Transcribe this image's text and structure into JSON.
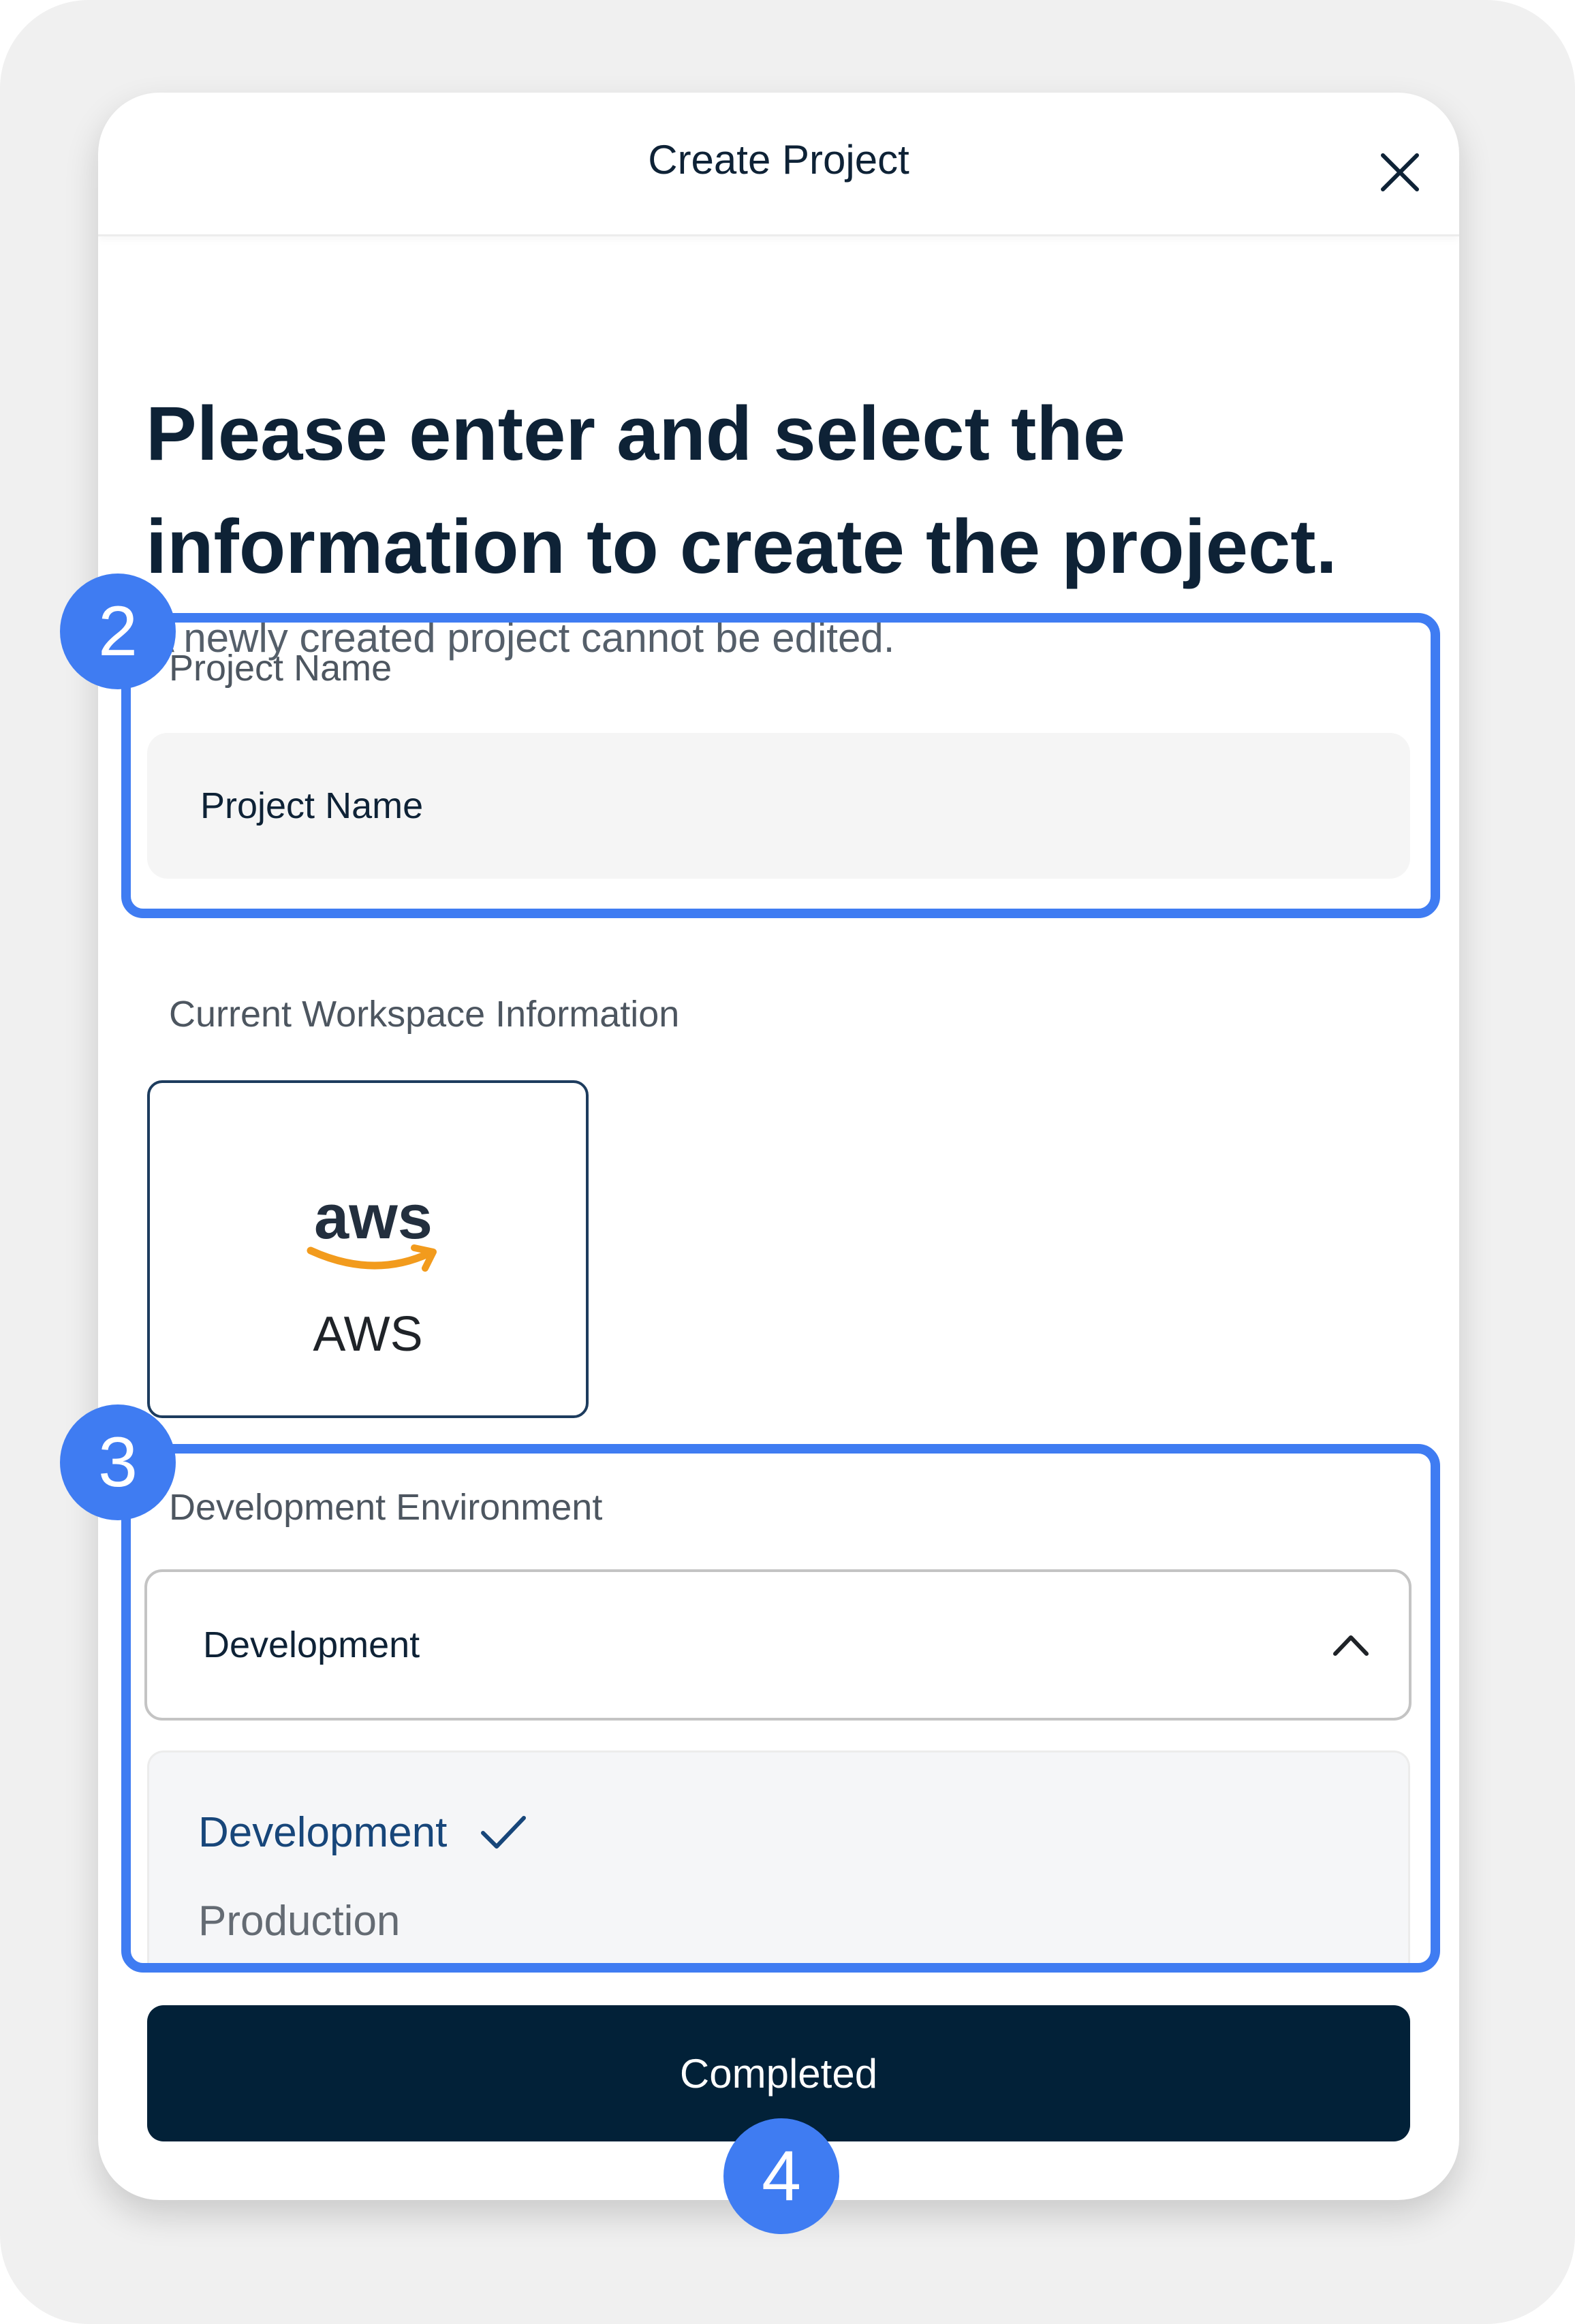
{
  "modal": {
    "title": "Create Project"
  },
  "heading": "Please enter and select the information to create the project.",
  "subtext": "A newly created project cannot be edited.",
  "project_name": {
    "label": "Project Name",
    "value": "Project Name"
  },
  "workspace": {
    "label": "Current Workspace Information",
    "provider_name": "AWS",
    "logo_text": "aws"
  },
  "environment": {
    "label": "Development Environment",
    "selected": "Development",
    "options": [
      {
        "label": "Development",
        "selected": true
      },
      {
        "label": "Production",
        "selected": false
      }
    ]
  },
  "submit": {
    "label": "Completed"
  },
  "annotations": {
    "steps": [
      "2",
      "3",
      "4"
    ]
  },
  "colors": {
    "primary": "#022138",
    "highlight": "#3f7cf2",
    "aws_orange": "#f29b1d",
    "selected_option": "#17467a"
  }
}
